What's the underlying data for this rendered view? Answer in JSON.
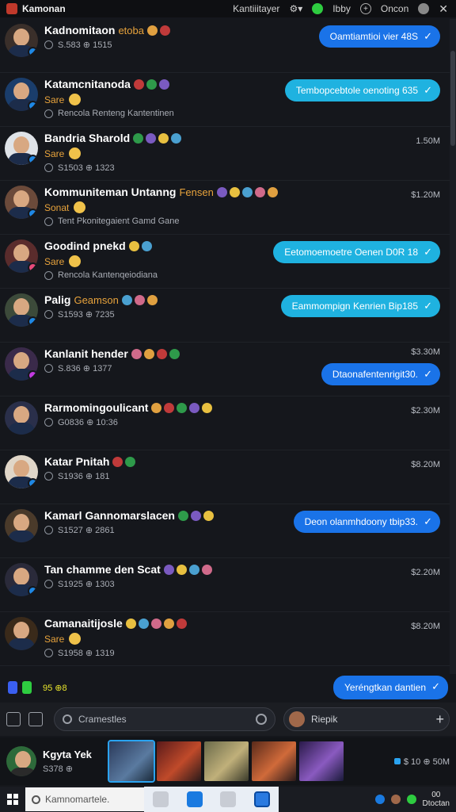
{
  "titlebar": {
    "app_title": "Kamonan",
    "menu_label": "Kantiiitayer",
    "user_label": "Ibby",
    "other_label": "Oncon",
    "close_glyph": "✕"
  },
  "rows": [
    {
      "name": "Kadnomitaon",
      "tag": "etoba",
      "status": "",
      "meta": "S.583  ⊕ 1515",
      "sub": "",
      "time": "",
      "bubble": "Oamtiamtioi vier 48S",
      "bubble_style": "blue",
      "avatar_bg": "#3a2f2a",
      "badge": "#1e88e5"
    },
    {
      "name": "Katamcnitanoda",
      "tag": "",
      "status": "Sare",
      "meta": "Rencola Renteng Kantentinen",
      "sub": "",
      "time": "",
      "bubble": "Tembopcebtole oenoting 635",
      "bubble_style": "cyan",
      "avatar_bg": "#1a3d6b",
      "badge": "#1e88e5"
    },
    {
      "name": "Bandria Sharold",
      "tag": "",
      "status": "Sare",
      "meta": "S1503  ⊕ 1323",
      "sub": "",
      "time": "1.50M",
      "bubble": "",
      "bubble_style": "",
      "avatar_bg": "#dfe3e8",
      "badge": "#1e88e5"
    },
    {
      "name": "Kommuniteman Untanng",
      "tag": "Fensen",
      "status": "Sonat",
      "meta": "Tent Pkonitegaient Gamd Gane",
      "sub": "",
      "time": "$1.20M",
      "bubble": "",
      "bubble_style": "",
      "avatar_bg": "#6b4a3a",
      "badge": "#1e88e5"
    },
    {
      "name": "Goodind pnekd",
      "tag": "",
      "status": "Sare",
      "meta": "Rencola Kantenqeiodiana",
      "sub": "",
      "time": "",
      "bubble": "Eetomoemoetre Oenen D0R 18",
      "bubble_style": "cyan",
      "avatar_bg": "#5a2c2c",
      "badge": "#e84a7a"
    },
    {
      "name": "Palig",
      "tag": "Geamson",
      "status": "",
      "meta": "S1593  ⊕ 7235",
      "sub": "",
      "time": "",
      "bubble": "Eammompign Kenrien Bip185",
      "bubble_style": "cyan",
      "avatar_bg": "#3c4a3a",
      "badge": "#1e88e5"
    },
    {
      "name": "Kanlanit hender",
      "tag": "",
      "status": "",
      "meta": "S.836  ⊕ 1377",
      "sub": "",
      "time": "$3.30M",
      "bubble": "Dtaonafentenrigit30.",
      "bubble_style": "blue",
      "avatar_bg": "#3a2a4a",
      "badge": "#c23adf"
    },
    {
      "name": "Rarmomingoulicant",
      "tag": "",
      "status": "",
      "meta": "G0836  ⊕ 10:36",
      "sub": "",
      "time": "$2.30M",
      "bubble": "",
      "bubble_style": "",
      "avatar_bg": "#2a2f4a",
      "badge": ""
    },
    {
      "name": "Katar Pnitah",
      "tag": "",
      "status": "",
      "meta": "S1936  ⊕ 181",
      "sub": "",
      "time": "$8.20M",
      "bubble": "",
      "bubble_style": "",
      "avatar_bg": "#e0d6c8",
      "badge": "#1e88e5"
    },
    {
      "name": "Kamarl Gannomarslacen",
      "tag": "",
      "status": "",
      "meta": "S1527  ⊕ 2861",
      "sub": "",
      "time": "",
      "bubble": "Deon olanmhdoony tbip33.",
      "bubble_style": "blue",
      "avatar_bg": "#4a3a2a",
      "badge": ""
    },
    {
      "name": "Tan chamme den Scat",
      "tag": "",
      "status": "",
      "meta": "S1925  ⊕ 1303",
      "sub": "",
      "time": "$2.20M",
      "bubble": "",
      "bubble_style": "",
      "avatar_bg": "#2a2a3a",
      "badge": "#1e88e5"
    },
    {
      "name": "Camanaitijosle",
      "tag": "",
      "status": "Sare",
      "meta": "S1958  ⊕ 1319",
      "sub": "",
      "time": "$8.20M",
      "bubble": "",
      "bubble_style": "",
      "avatar_bg": "#3a2a1a",
      "badge": ""
    }
  ],
  "strip": {
    "digits": "95 ⊕8",
    "bubble": "Yeréngtkan dantien"
  },
  "input": {
    "search_placeholder": "Cramestles",
    "reply_label": "Riepik"
  },
  "profile": {
    "name": "Kgyta Yek",
    "meta": "S378  ⊕",
    "right": "$ 10 ⊕ 50M"
  },
  "taskbar": {
    "search_placeholder": "Kamnomartele.",
    "clock_top": "00",
    "clock_bottom": "Dtoctan"
  }
}
